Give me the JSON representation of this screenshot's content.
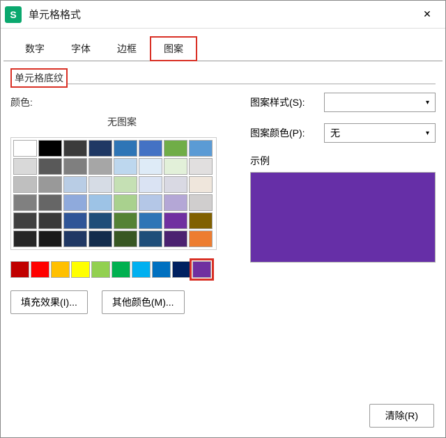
{
  "title": "单元格格式",
  "tabs": {
    "number": "数字",
    "font": "字体",
    "border": "边框",
    "pattern": "图案"
  },
  "section": {
    "shading": "单元格底纹",
    "color": "颜色:",
    "no_pattern": "无图案"
  },
  "right": {
    "pattern_style_label": "图案样式(S):",
    "pattern_color_label": "图案颜色(P):",
    "pattern_style_value": "",
    "pattern_color_value": "无",
    "sample_label": "示例",
    "sample_color": "#662fa7"
  },
  "buttons": {
    "fill_effects": "填充效果(I)...",
    "more_colors": "其他颜色(M)...",
    "clear": "清除(R)"
  },
  "palette_main": [
    [
      "#ffffff",
      "#000000",
      "#3b3b3b",
      "#1f3864",
      "#2e75b6",
      "#4472c4",
      "#70ad47",
      "#5b9bd5"
    ],
    [
      "#d9d9d9",
      "#595959",
      "#7f7f7f",
      "#a6a6a6",
      "#bdd7ee",
      "#deebf7",
      "#e2f0d9",
      "#e1dfdf"
    ],
    [
      "#bfbfbf",
      "#999999",
      "#b9cde5",
      "#d6dce5",
      "#c5e0b4",
      "#dae3f3",
      "#d9d9e3",
      "#efe6dc"
    ],
    [
      "#808080",
      "#666666",
      "#8faadc",
      "#9dc3e6",
      "#a9d18e",
      "#b4c7e7",
      "#b4a7d6",
      "#d0cece"
    ],
    [
      "#404040",
      "#3a3a3a",
      "#2f5597",
      "#1f4e79",
      "#548235",
      "#2e75b6",
      "#7030a0",
      "#806000"
    ],
    [
      "#262626",
      "#1a1a1a",
      "#203864",
      "#132c4c",
      "#385723",
      "#1f4e79",
      "#4b2170",
      "#ed7d31"
    ]
  ],
  "palette_accent": [
    "#c00000",
    "#ff0000",
    "#ffc000",
    "#ffff00",
    "#92d050",
    "#00b050",
    "#00b0f0",
    "#0070c0",
    "#002060",
    "#7030a0"
  ],
  "selected_accent_index": 9
}
